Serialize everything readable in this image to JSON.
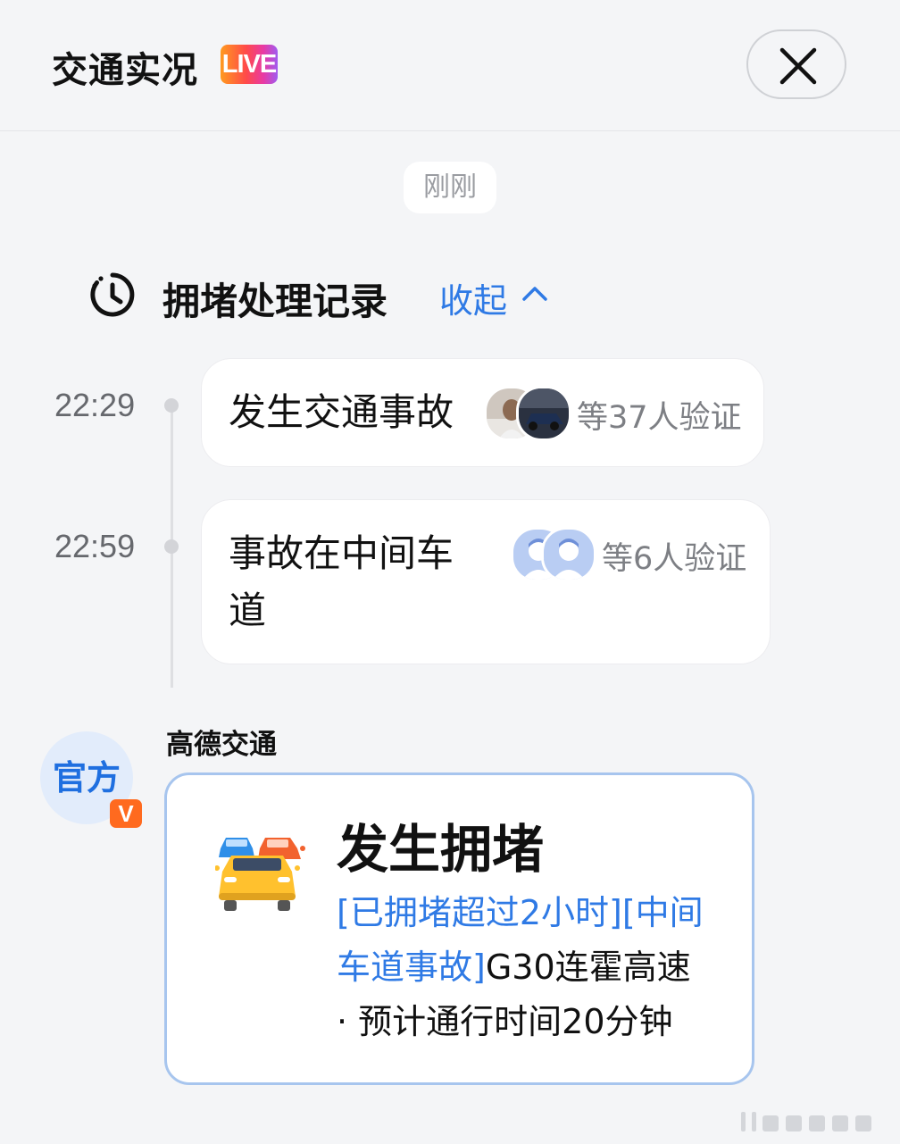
{
  "header": {
    "title": "交通实况",
    "live_badge": "LIVE",
    "close_icon": "close-icon"
  },
  "timestamp_pill": "刚刚",
  "record_section": {
    "icon": "history-clock-icon",
    "title": "拥堵处理记录",
    "collapse_label": "收起",
    "collapse_icon": "chevron-up-icon"
  },
  "timeline": [
    {
      "time": "22:29",
      "event_line1": "发生交通事故",
      "event_line2": "",
      "verify_text": "等37人验证",
      "avatars": [
        "user-photo-avatar",
        "car-photo-avatar"
      ]
    },
    {
      "time": "22:59",
      "event_line1": "事故在中间车",
      "event_line2": "道",
      "verify_text": "等6人验证",
      "avatars": [
        "default-user-avatar",
        "default-user-avatar"
      ]
    }
  ],
  "official": {
    "source_name": "高德交通",
    "avatar_label": "官方",
    "verified_badge": "V",
    "card_icon": "traffic-jam-cars-icon",
    "card_title": "发生拥堵",
    "tag1": "[已拥堵超过2小时]",
    "tag2": "[中间车道事故]",
    "road": "G30连霍高速",
    "eta": "· 预计通行时间20分钟"
  },
  "colors": {
    "accent_blue": "#2f7ae5",
    "card_border": "#a7c5ee",
    "background": "#f4f5f7"
  }
}
